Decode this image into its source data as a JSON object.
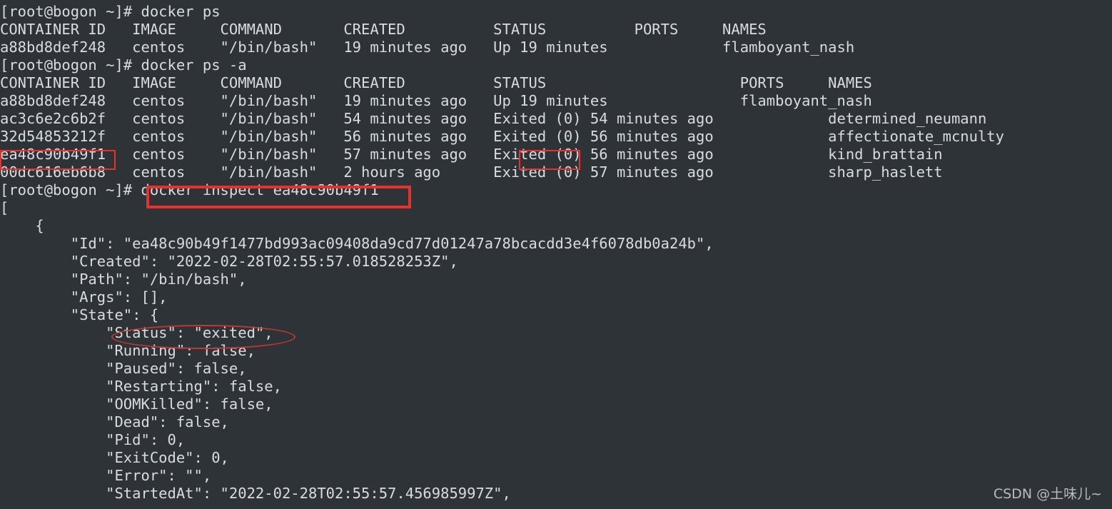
{
  "terminal": {
    "background_color": "#2e3338",
    "foreground_color": "#d9dcde",
    "annotation_color": "#e8312a",
    "prompt": "[root@bogon ~]# ",
    "commands": {
      "docker_ps": "docker ps",
      "docker_ps_a": "docker ps -a",
      "docker_inspect": "docker inspect ea48c90b49f1"
    },
    "lines": [
      "[root@bogon ~]# docker ps",
      "CONTAINER ID   IMAGE     COMMAND       CREATED          STATUS          PORTS     NAMES",
      "a88bd8def248   centos    \"/bin/bash\"   19 minutes ago   Up 19 minutes             flamboyant_nash",
      "[root@bogon ~]# docker ps -a",
      "CONTAINER ID   IMAGE     COMMAND       CREATED          STATUS                      PORTS     NAMES",
      "a88bd8def248   centos    \"/bin/bash\"   19 minutes ago   Up 19 minutes               flamboyant_nash",
      "ac3c6e2c6b2f   centos    \"/bin/bash\"   54 minutes ago   Exited (0) 54 minutes ago             determined_neumann",
      "32d54853212f   centos    \"/bin/bash\"   56 minutes ago   Exited (0) 56 minutes ago             affectionate_mcnulty",
      "ea48c90b49f1   centos    \"/bin/bash\"   57 minutes ago   Exited (0) 56 minutes ago             kind_brattain",
      "00dc616eb6b8   centos    \"/bin/bash\"   2 hours ago      Exited (0) 57 minutes ago             sharp_haslett",
      "[root@bogon ~]# docker inspect ea48c90b49f1",
      "[",
      "    {",
      "        \"Id\": \"ea48c90b49f1477bd993ac09408da9cd77d01247a78bcacdd3e4f6078db0a24b\",",
      "        \"Created\": \"2022-02-28T02:55:57.018528253Z\",",
      "        \"Path\": \"/bin/bash\",",
      "        \"Args\": [],",
      "        \"State\": {",
      "            \"Status\": \"exited\",",
      "            \"Running\": false,",
      "            \"Paused\": false,",
      "            \"Restarting\": false,",
      "            \"OOMKilled\": false,",
      "            \"Dead\": false,",
      "            \"Pid\": 0,",
      "            \"ExitCode\": 0,",
      "            \"Error\": \"\",",
      "            \"StartedAt\": \"2022-02-28T02:55:57.456985997Z\","
    ]
  },
  "docker_ps_table": {
    "headers": [
      "CONTAINER ID",
      "IMAGE",
      "COMMAND",
      "CREATED",
      "STATUS",
      "PORTS",
      "NAMES"
    ],
    "rows": [
      {
        "container_id": "a88bd8def248",
        "image": "centos",
        "command": "\"/bin/bash\"",
        "created": "19 minutes ago",
        "status": "Up 19 minutes",
        "ports": "",
        "names": "flamboyant_nash"
      }
    ]
  },
  "docker_ps_a_table": {
    "headers": [
      "CONTAINER ID",
      "IMAGE",
      "COMMAND",
      "CREATED",
      "STATUS",
      "PORTS",
      "NAMES"
    ],
    "rows": [
      {
        "container_id": "a88bd8def248",
        "image": "centos",
        "command": "\"/bin/bash\"",
        "created": "19 minutes ago",
        "status": "Up 19 minutes",
        "ports": "",
        "names": "flamboyant_nash"
      },
      {
        "container_id": "ac3c6e2c6b2f",
        "image": "centos",
        "command": "\"/bin/bash\"",
        "created": "54 minutes ago",
        "status": "Exited (0) 54 minutes ago",
        "ports": "",
        "names": "determined_neumann"
      },
      {
        "container_id": "32d54853212f",
        "image": "centos",
        "command": "\"/bin/bash\"",
        "created": "56 minutes ago",
        "status": "Exited (0) 56 minutes ago",
        "ports": "",
        "names": "affectionate_mcnulty"
      },
      {
        "container_id": "ea48c90b49f1",
        "image": "centos",
        "command": "\"/bin/bash\"",
        "created": "57 minutes ago",
        "status": "Exited (0) 56 minutes ago",
        "ports": "",
        "names": "kind_brattain"
      },
      {
        "container_id": "00dc616eb6b8",
        "image": "centos",
        "command": "\"/bin/bash\"",
        "created": "2 hours ago",
        "status": "Exited (0) 57 minutes ago",
        "ports": "",
        "names": "sharp_haslett"
      }
    ]
  },
  "inspect_output": {
    "open_bracket": "[",
    "open_brace": "{",
    "id": "ea48c90b49f1477bd993ac09408da9cd77d01247a78bcacdd3e4f6078db0a24b",
    "created": "2022-02-28T02:55:57.018528253Z",
    "path": "/bin/bash",
    "args": "[]",
    "state": {
      "status": "exited",
      "running": "false",
      "paused": "false",
      "restarting": "false",
      "oom_killed": "false",
      "dead": "false",
      "pid": "0",
      "exit_code": "0",
      "error": "\"\"",
      "started_at": "2022-02-28T02:55:57.456985997Z"
    }
  },
  "annotations": {
    "highlight_container_id": "ea48c90b49f1",
    "highlight_status_word": "Exited",
    "highlight_command": "docker inspect ea48c90b49f1",
    "highlight_status_field": "\"Status\": \"exited\","
  },
  "watermark": {
    "text": "CSDN @土味儿~"
  }
}
